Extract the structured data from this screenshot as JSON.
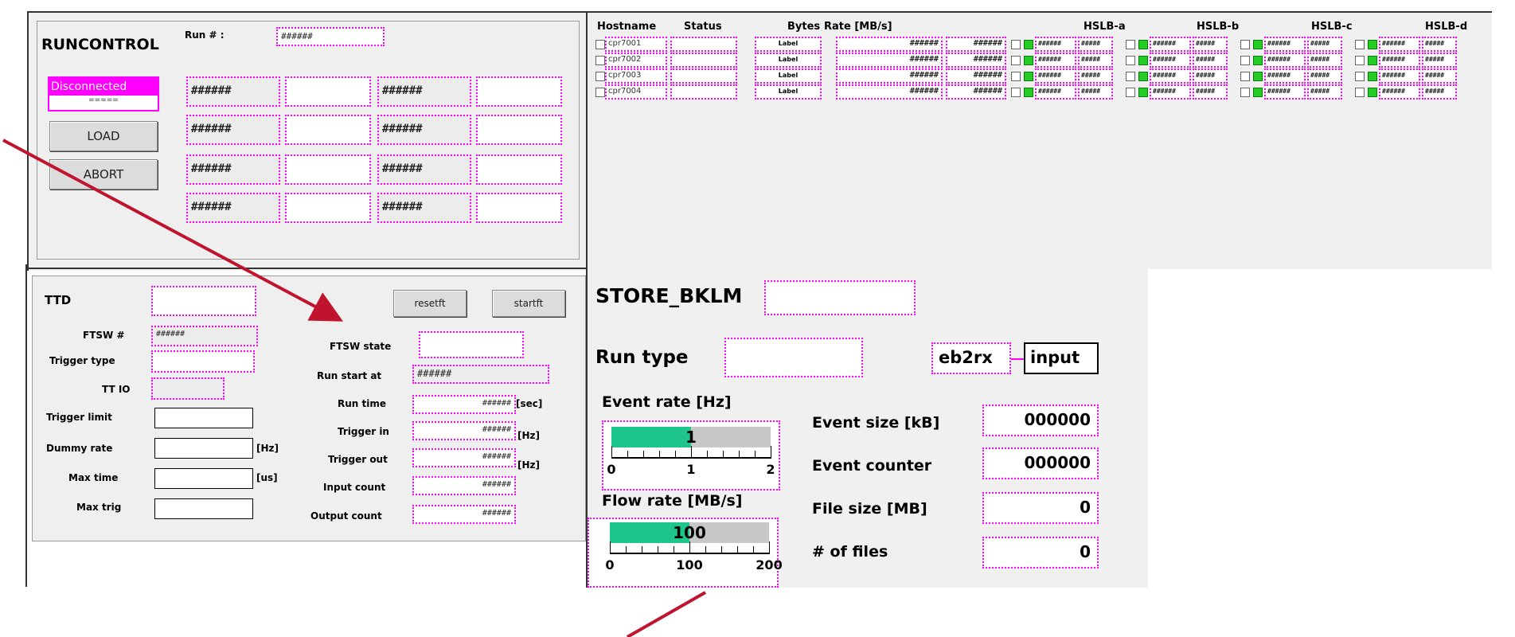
{
  "runcontrol": {
    "title": "RUNCONTROL",
    "run_label": "Run # :",
    "run_value": "######",
    "state": "Disconnected",
    "state_sub": "=====",
    "load": "LOAD",
    "abort": "ABORT",
    "grid": [
      [
        "######",
        "",
        "######",
        ""
      ],
      [
        "######",
        "",
        "######",
        ""
      ],
      [
        "######",
        "",
        "######",
        ""
      ],
      [
        "######",
        "",
        "######",
        ""
      ]
    ]
  },
  "hosts": {
    "headers": {
      "hostname": "Hostname",
      "status": "Status",
      "bytes": "Bytes",
      "rate": "Rate [MB/s]",
      "a": "HSLB-a",
      "b": "HSLB-b",
      "c": "HSLB-c",
      "d": "HSLB-d"
    },
    "rows": [
      {
        "name": "cpr7001",
        "label": "Label",
        "v1": "######",
        "v2": "######",
        "h": "######",
        "h2": "#####"
      },
      {
        "name": "cpr7002",
        "label": "Label",
        "v1": "######",
        "v2": "######",
        "h": "######",
        "h2": "#####"
      },
      {
        "name": "cpr7003",
        "label": "Label",
        "v1": "######",
        "v2": "######",
        "h": "######",
        "h2": "#####"
      },
      {
        "name": "cpr7004",
        "label": "Label",
        "v1": "######",
        "v2": "######",
        "h": "######",
        "h2": "#####"
      }
    ]
  },
  "ttd": {
    "title": "TTD",
    "resetft": "resetft",
    "startft": "startft",
    "ftsw_num_label": "FTSW #",
    "ftsw_num": "######",
    "trigger_type": "Trigger type",
    "ttio": "TT IO",
    "trigger_limit": "Trigger limit",
    "dummy_rate": "Dummy rate",
    "max_time": "Max time",
    "max_trig": "Max trig",
    "hz": "[Hz]",
    "us": "[us]",
    "ftsw_state": "FTSW state",
    "run_start_at": "Run start at",
    "run_start_val": "######",
    "run_time": "Run time",
    "run_time_val": "######",
    "sec": "[sec]",
    "trigger_in": "Trigger in",
    "trigger_in_val": "######",
    "trigger_out": "Trigger out",
    "trigger_out_val": "######",
    "input_count": "Input count",
    "input_count_val": "######",
    "output_count": "Output count",
    "output_count_val": "######"
  },
  "store": {
    "title": "STORE_BKLM",
    "run_type": "Run type",
    "eb2rx": "eb2rx",
    "input": "input",
    "event_rate": "Event rate [Hz]",
    "event_rate_val": "1",
    "event_rate_frac": 0.5,
    "er_ticks": [
      "0",
      "1",
      "2"
    ],
    "flow_rate": "Flow rate [MB/s]",
    "flow_rate_val": "100",
    "flow_rate_frac": 0.5,
    "fr_ticks": [
      "0",
      "100",
      "200"
    ],
    "event_size": "Event size [kB]",
    "event_size_val": "000000",
    "event_counter": "Event counter",
    "event_counter_val": "000000",
    "file_size": "File size [MB]",
    "file_size_val": "0",
    "num_files": "# of files",
    "num_files_val": "0"
  }
}
